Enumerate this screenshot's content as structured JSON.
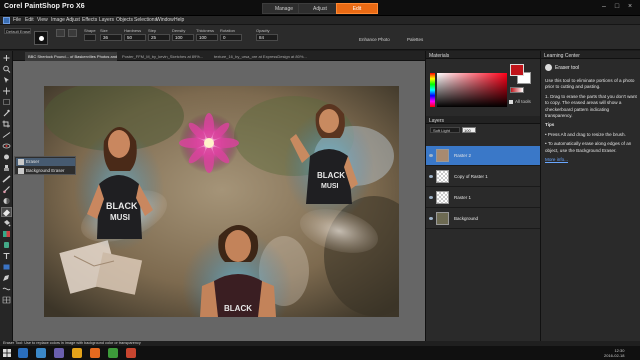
{
  "app": {
    "title": "Corel PaintShop Pro X6"
  },
  "workspace_tabs": {
    "manage": "Manage",
    "adjust": "Adjust",
    "edit": "Edit"
  },
  "menu": [
    "File",
    "Edit",
    "View",
    "Image",
    "Adjust",
    "Effects",
    "Layers",
    "Objects",
    "Selections",
    "Window",
    "Help"
  ],
  "tool_options": {
    "preset": "Default Eraser",
    "fields": [
      {
        "label": "Shape",
        "value": ""
      },
      {
        "label": "Size",
        "value": "36"
      },
      {
        "label": "Hardness",
        "value": "50"
      },
      {
        "label": "Step",
        "value": "25"
      },
      {
        "label": "Density",
        "value": "100"
      },
      {
        "label": "Thickness",
        "value": "100"
      },
      {
        "label": "Rotation",
        "value": "0"
      },
      {
        "label": "Opacity",
        "value": "84"
      }
    ],
    "palettes": [
      "Enhance Photo",
      "Palettes"
    ]
  },
  "doc_tabs": [
    "BBC Sherlock Pound... of Baskervilles Photos and... ",
    "Poster_FFM_M_by_kevin_Sketches at 89%...",
    "texture_16_by_ursa_ore at ExpressDesign at 80%..."
  ],
  "flyout": {
    "items": [
      "Eraser",
      "Background Eraser"
    ]
  },
  "materials": {
    "title": "Materials",
    "all_tools": "All tools",
    "fg_color": "#c0141a",
    "bg_color": "#ffffff"
  },
  "layers": {
    "title": "Layers",
    "blend": "Soft Light",
    "opacity": "100",
    "rows": [
      {
        "name": "Raster 2",
        "selected": true
      },
      {
        "name": "Copy of Raster 1",
        "selected": false
      },
      {
        "name": "Raster 1",
        "selected": false
      },
      {
        "name": "Background",
        "selected": false
      }
    ]
  },
  "learning": {
    "title": "Learning Center",
    "tool": "Eraser tool",
    "intro": "Use this tool to eliminate portions of a photo prior to cutting and pasting.",
    "step": "1. Drag to erase the parts that you don't want to copy. The erased areas will show a checkerboard pattern indicating transparency.",
    "tips_label": "Tips",
    "tips": [
      "Press Alt and drag to resize the brush.",
      "To automatically erase along edges of an object, use the Background Eraser."
    ],
    "more": "More info..."
  },
  "status": {
    "text": "Eraser Tool: Use to replace colors in image with background color or transparency"
  },
  "taskbar": {
    "time": "12:30",
    "date": "2016-02-18"
  }
}
